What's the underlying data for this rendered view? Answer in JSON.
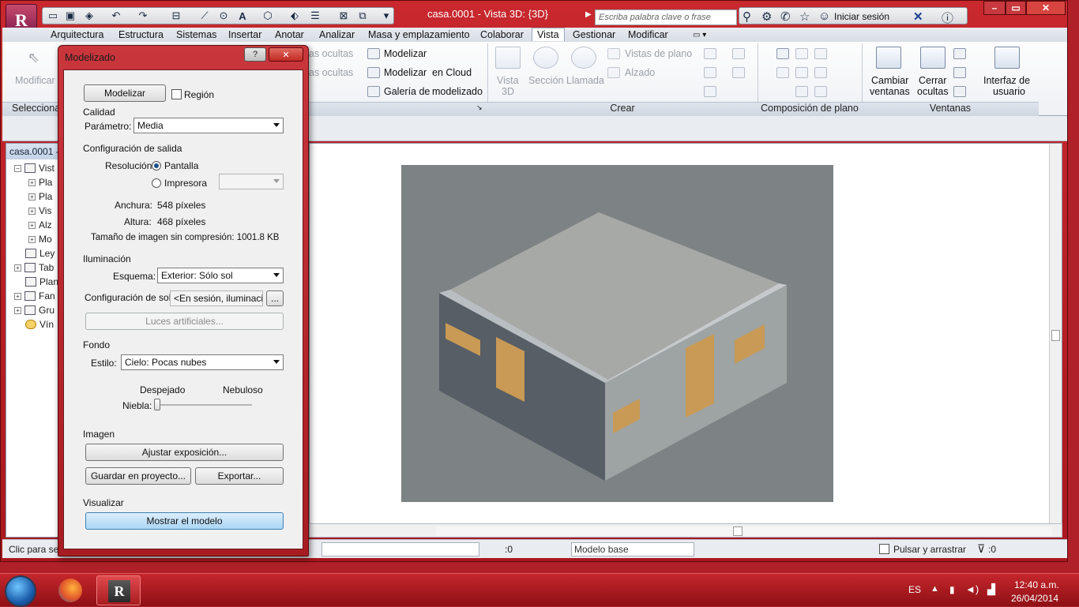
{
  "app": {
    "document_title": "casa.0001 - Vista 3D: {3D}",
    "search_placeholder": "Escriba palabra clave o frase",
    "signin_label": "Iniciar sesión",
    "logo_letter": "R"
  },
  "ribbon": {
    "tabs": [
      {
        "label": "Arquitectura"
      },
      {
        "label": "Estructura"
      },
      {
        "label": "Sistemas"
      },
      {
        "label": "Insertar"
      },
      {
        "label": "Anotar"
      },
      {
        "label": "Analizar"
      },
      {
        "label": "Masa y emplazamiento"
      },
      {
        "label": "Colaborar"
      },
      {
        "label": "Vista"
      },
      {
        "label": "Gestionar"
      },
      {
        "label": "Modificar"
      }
    ],
    "modify_label": "Modificar",
    "select_label": "Seleccionar",
    "hidden_ocultas_1": "as ocultas",
    "hidden_ocultas_2": "as ocultas",
    "graphics": {
      "modelizar": "Modelizar",
      "modelizar_cloud_a": "Modelizar",
      "modelizar_cloud_b": "en Cloud",
      "galeria_a": "Galería de",
      "galeria_b": "modelizado"
    },
    "create": {
      "vista3d": "Vista",
      "vista3d_b": "3D",
      "seccion": "Sección",
      "llamada": "Llamada",
      "vistas_plano": "Vistas de plano",
      "alzado": "Alzado",
      "title": "Crear"
    },
    "sheet_title": "Composición de plano",
    "windows": {
      "cambiar_a": "Cambiar",
      "cambiar_b": "ventanas",
      "cerrar_a": "Cerrar",
      "cerrar_b": "ocultas",
      "interfaz_a": "Interfaz de",
      "interfaz_b": "usuario",
      "title": "Ventanas"
    }
  },
  "project_browser": {
    "title": "casa.0001 -",
    "items": [
      {
        "label": "Vist"
      },
      {
        "label": "Pla"
      },
      {
        "label": "Pla"
      },
      {
        "label": "Vis"
      },
      {
        "label": "Alz"
      },
      {
        "label": "Mo"
      },
      {
        "label": "Ley"
      },
      {
        "label": "Tab"
      },
      {
        "label": "Plan"
      },
      {
        "label": "Fan"
      },
      {
        "label": "Gru"
      },
      {
        "label": "Vín"
      }
    ]
  },
  "status": {
    "left_text": "Clic para sel",
    "count_a": ":0",
    "model_base": "Modelo base",
    "drag_label": "Pulsar y arrastrar",
    "filter_count": ":0"
  },
  "dialog": {
    "title": "Modelizado",
    "help": "?",
    "close": "✕",
    "render_button": "Modelizar",
    "region_label": "Región",
    "quality": {
      "title": "Calidad",
      "param_label": "Parámetro:",
      "param_value": "Media"
    },
    "output": {
      "title": "Configuración de salida",
      "resolution_label": "Resolución:",
      "screen_label": "Pantalla",
      "printer_label": "Impresora",
      "width_label": "Anchura:",
      "width_value": "548 píxeles",
      "height_label": "Altura:",
      "height_value": "468 píxeles",
      "size_label": "Tamaño de imagen sin compresión: 1001.8 KB"
    },
    "lighting": {
      "title": "Iluminación",
      "scheme_label": "Esquema:",
      "scheme_value": "Exterior: Sólo sol",
      "sun_label": "Configuración de sol:",
      "sun_value": "<En sesión, iluminación>",
      "sun_button": "...",
      "artificial_button": "Luces artificiales..."
    },
    "background": {
      "title": "Fondo",
      "style_label": "Estilo:",
      "style_value": "Cielo: Pocas nubes",
      "clear_label": "Despejado",
      "cloudy_label": "Nebuloso",
      "haze_label": "Niebla:",
      "haze_level": 0
    },
    "image": {
      "title": "Imagen",
      "exposure_button": "Ajustar exposición...",
      "save_button": "Guardar en proyecto...",
      "export_button": "Exportar..."
    },
    "display": {
      "title": "Visualizar",
      "show_model_button": "Mostrar el modelo"
    }
  },
  "taskbar": {
    "lang": "ES",
    "time": "12:40 a.m.",
    "date": "26/04/2014"
  },
  "colors": {
    "frame": "#b02028",
    "render_background": "#7d8384",
    "roof": "#a7a9a6",
    "wall_left": "#575e66",
    "wall_right": "#9ea3a3",
    "wood": "#c89a55"
  }
}
